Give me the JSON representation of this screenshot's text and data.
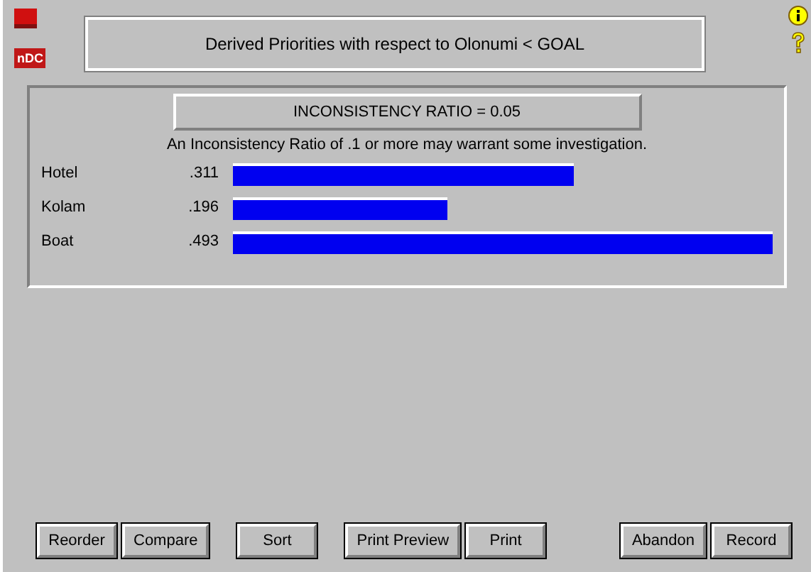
{
  "logo_badge": "nDC",
  "title": "Derived Priorities with respect to Olonumi < GOAL",
  "ratio_label": "INCONSISTENCY RATIO = 0.05",
  "note": "An Inconsistency Ratio of .1 or more may warrant some investigation.",
  "priorities": [
    {
      "name": "Hotel",
      "value": ".311"
    },
    {
      "name": "Kolam",
      "value": ".196"
    },
    {
      "name": "Boat",
      "value": ".493"
    }
  ],
  "button_groups": [
    [
      "Reorder",
      "Compare"
    ],
    [
      "Sort"
    ],
    [
      "Print Preview",
      "Print"
    ],
    [
      "Abandon",
      "Record"
    ]
  ]
}
